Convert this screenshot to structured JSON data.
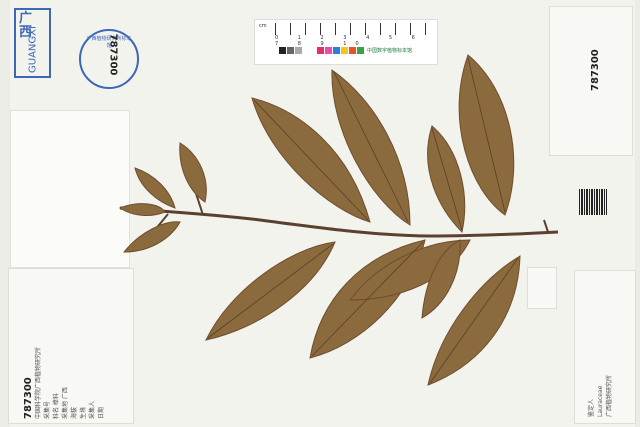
{
  "herbarium": {
    "stamp_top": "广 西",
    "stamp_bottom": "GUANGXI",
    "seal_number": "787300",
    "seal_text": "广西植物研究所标本馆"
  },
  "ruler": {
    "unit": "cm",
    "ticks": "0 1 2 3 4 5 6 7 8 9 10",
    "brand": "中国数字植物标本馆"
  },
  "labels": {
    "right_top_number": "787300",
    "left_bottom_number": "787300",
    "left_bottom_lines": [
      "中国科学院广西植物研究所",
      "采集号",
      "科名 樟科",
      "采集地 广西",
      "海拔",
      "生境",
      "采集人",
      "日期"
    ],
    "right_bottom_lines": [
      "鉴定人",
      "Lauraceae",
      "广西植物研究所"
    ]
  },
  "colors": {
    "leaf": "#8b6a3e",
    "leaf_dark": "#6f4e2e",
    "stem": "#5b4030",
    "stamp_blue": "#3d68b5"
  }
}
